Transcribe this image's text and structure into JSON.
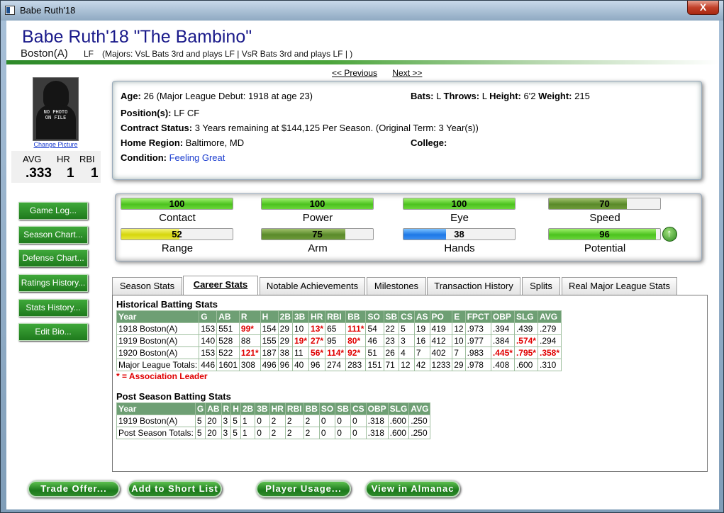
{
  "window": {
    "title": "Babe Ruth'18",
    "close": "X"
  },
  "header": {
    "name": "Babe Ruth'18  \"The Bambino\"",
    "team": "Boston(A)",
    "position": "LF",
    "role": "(Majors: VsL Bats 3rd and plays LF | VsR Bats 3rd and plays LF | )"
  },
  "nav": {
    "previous": "<< Previous",
    "next": "Next >>"
  },
  "photo": {
    "text1": "NO PHOTO",
    "text2": "ON FILE",
    "change": "Change Picture"
  },
  "mini": {
    "avg_label": "AVG",
    "hr_label": "HR",
    "rbi_label": "RBI",
    "avg": ".333",
    "hr": "1",
    "rbi": "1"
  },
  "side_buttons": [
    "Game Log...",
    "Season Chart...",
    "Defense Chart...",
    "Ratings History...",
    "Stats History...",
    "Edit Bio..."
  ],
  "info": {
    "age_label": "Age:",
    "age": "26  (Major League Debut: 1918 at age 23)",
    "bats_label": "Bats:",
    "bats": "L",
    "throws_label": "Throws:",
    "throws": "L",
    "height_label": "Height:",
    "height": "6'2",
    "weight_label": "Weight:",
    "weight": "215",
    "positions_label": "Position(s):",
    "positions": "LF CF",
    "contract_label": "Contract Status:",
    "contract": "3 Years remaining at $144,125 Per Season. (Original Term: 3 Year(s))",
    "region_label": "Home Region:",
    "region": "Baltimore, MD",
    "college_label": "College:",
    "college": "",
    "condition_label": "Condition:",
    "condition": "Feeling Great"
  },
  "ratings": [
    {
      "label": "Contact",
      "value": "100",
      "pct": 100,
      "color": "bright"
    },
    {
      "label": "Power",
      "value": "100",
      "pct": 100,
      "color": "bright"
    },
    {
      "label": "Eye",
      "value": "100",
      "pct": 100,
      "color": "bright"
    },
    {
      "label": "Speed",
      "value": "70",
      "pct": 70,
      "color": "olive"
    },
    {
      "label": "Range",
      "value": "52",
      "pct": 52,
      "color": "yellow"
    },
    {
      "label": "Arm",
      "value": "75",
      "pct": 75,
      "color": "olive"
    },
    {
      "label": "Hands",
      "value": "38",
      "pct": 38,
      "color": "blue"
    },
    {
      "label": "Potential",
      "value": "96",
      "pct": 96,
      "color": "bright"
    }
  ],
  "tabs": [
    "Season Stats",
    "Career Stats",
    "Notable Achievements",
    "Milestones",
    "Transaction History",
    "Splits",
    "Real Major League Stats"
  ],
  "active_tab": 1,
  "historical": {
    "title": "Historical Batting Stats",
    "headers": [
      "Year",
      "G",
      "AB",
      "R",
      "H",
      "2B",
      "3B",
      "HR",
      "RBI",
      "BB",
      "SO",
      "SB",
      "CS",
      "AS",
      "PO",
      "E",
      "FPCT",
      "OBP",
      "SLG",
      "AVG"
    ],
    "rows": [
      [
        "1918 Boston(A)",
        "153",
        "551",
        "99*",
        "154",
        "29",
        "10",
        "13*",
        "65",
        "111*",
        "54",
        "22",
        "5",
        "19",
        "419",
        "12",
        ".973",
        ".394",
        ".439",
        ".279"
      ],
      [
        "1919 Boston(A)",
        "140",
        "528",
        "88",
        "155",
        "29",
        "19*",
        "27*",
        "95",
        "80*",
        "46",
        "23",
        "3",
        "16",
        "412",
        "10",
        ".977",
        ".384",
        ".574*",
        ".294"
      ],
      [
        "1920 Boston(A)",
        "153",
        "522",
        "121*",
        "187",
        "38",
        "11",
        "56*",
        "114*",
        "92*",
        "51",
        "26",
        "4",
        "7",
        "402",
        "7",
        ".983",
        ".445*",
        ".795*",
        ".358*"
      ],
      [
        "Major League Totals:",
        "446",
        "1601",
        "308",
        "496",
        "96",
        "40",
        "96",
        "274",
        "283",
        "151",
        "71",
        "12",
        "42",
        "1233",
        "29",
        ".978",
        ".408",
        ".600",
        ".310"
      ]
    ],
    "legend": "* = Association Leader"
  },
  "postseason": {
    "title": "Post Season Batting Stats",
    "headers": [
      "Year",
      "G",
      "AB",
      "R",
      "H",
      "2B",
      "3B",
      "HR",
      "RBI",
      "BB",
      "SO",
      "SB",
      "CS",
      "OBP",
      "SLG",
      "AVG"
    ],
    "rows": [
      [
        "1919 Boston(A)",
        "5",
        "20",
        "3",
        "5",
        "1",
        "0",
        "2",
        "2",
        "2",
        "0",
        "0",
        "0",
        ".318",
        ".600",
        ".250"
      ],
      [
        "Post Season Totals:",
        "5",
        "20",
        "3",
        "5",
        "1",
        "0",
        "2",
        "2",
        "2",
        "0",
        "0",
        "0",
        ".318",
        ".600",
        ".250"
      ]
    ]
  },
  "bottom_buttons": [
    "Trade Offer...",
    "Add to Short List",
    "Player Usage...",
    "View in Almanac"
  ]
}
